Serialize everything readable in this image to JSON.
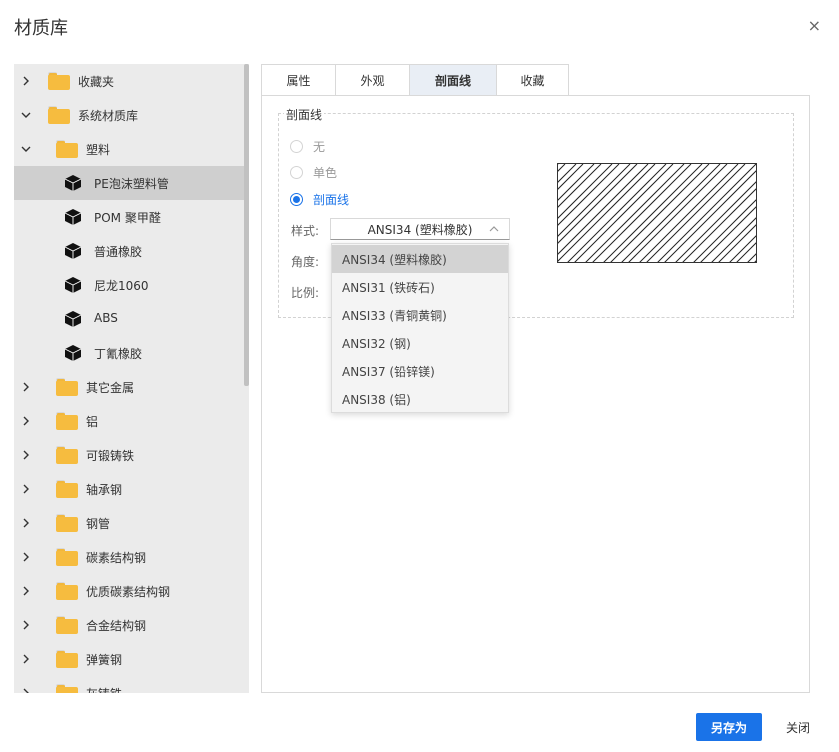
{
  "dialog": {
    "title": "材质库",
    "close_glyph": "×"
  },
  "tree": {
    "nodes": [
      {
        "label": "收藏夹",
        "type": "folder",
        "level": 0,
        "expanded": false
      },
      {
        "label": "系统材质库",
        "type": "folder",
        "level": 0,
        "expanded": true
      },
      {
        "label": "塑料",
        "type": "folder",
        "level": 1,
        "expanded": true
      },
      {
        "label": "PE泡沫塑料管",
        "type": "material",
        "level": 2,
        "selected": true
      },
      {
        "label": "POM 聚甲醛",
        "type": "material",
        "level": 2
      },
      {
        "label": "普通橡胶",
        "type": "material",
        "level": 2
      },
      {
        "label": "尼龙1060",
        "type": "material",
        "level": 2
      },
      {
        "label": "ABS",
        "type": "material",
        "level": 2
      },
      {
        "label": "丁氰橡胶",
        "type": "material",
        "level": 2
      },
      {
        "label": "其它金属",
        "type": "folder",
        "level": 1,
        "expanded": false
      },
      {
        "label": "铝",
        "type": "folder",
        "level": 1,
        "expanded": false
      },
      {
        "label": "可锻铸铁",
        "type": "folder",
        "level": 1,
        "expanded": false
      },
      {
        "label": "轴承钢",
        "type": "folder",
        "level": 1,
        "expanded": false
      },
      {
        "label": "钢管",
        "type": "folder",
        "level": 1,
        "expanded": false
      },
      {
        "label": "碳素结构钢",
        "type": "folder",
        "level": 1,
        "expanded": false
      },
      {
        "label": "优质碳素结构钢",
        "type": "folder",
        "level": 1,
        "expanded": false
      },
      {
        "label": "合金结构钢",
        "type": "folder",
        "level": 1,
        "expanded": false
      },
      {
        "label": "弹簧钢",
        "type": "folder",
        "level": 1,
        "expanded": false
      },
      {
        "label": "灰铸铁",
        "type": "folder",
        "level": 1,
        "expanded": false
      }
    ]
  },
  "tabs": [
    {
      "label": "属性",
      "active": false
    },
    {
      "label": "外观",
      "active": false
    },
    {
      "label": "剖面线",
      "active": true
    },
    {
      "label": "收藏",
      "active": false
    }
  ],
  "hatch_section": {
    "legend": "剖面线",
    "radios": [
      {
        "label": "无",
        "checked": false
      },
      {
        "label": "单色",
        "checked": false
      },
      {
        "label": "剖面线",
        "checked": true
      }
    ],
    "style_label": "样式:",
    "style_value": "ANSI34 (塑料橡胶)",
    "angle_label": "角度:",
    "scale_label": "比例:",
    "dropdown_options": [
      {
        "label": "ANSI34 (塑料橡胶)",
        "selected": true
      },
      {
        "label": "ANSI31 (铁砖石)",
        "selected": false
      },
      {
        "label": "ANSI33 (青铜黄铜)",
        "selected": false
      },
      {
        "label": "ANSI32 (钢)",
        "selected": false
      },
      {
        "label": "ANSI37 (铅锌镁)",
        "selected": false
      },
      {
        "label": "ANSI38 (铝)",
        "selected": false
      }
    ]
  },
  "footer": {
    "save_as_label": "另存为",
    "close_label": "关闭"
  },
  "colors": {
    "accent": "#1a73e8",
    "folder": "#f6bc3f",
    "tree_bg": "#ebebeb",
    "selected_row": "#cfcfcf"
  }
}
